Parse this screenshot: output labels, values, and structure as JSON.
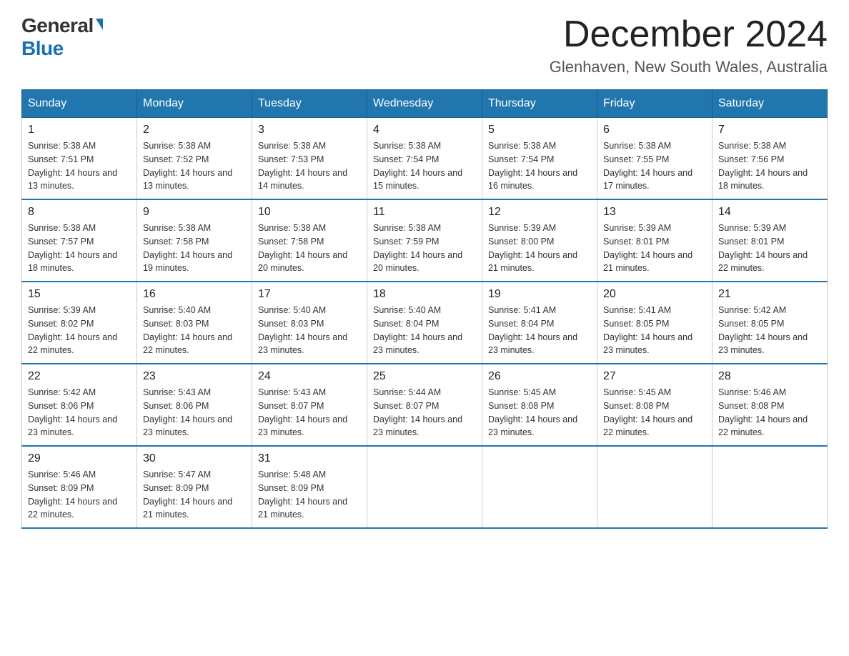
{
  "header": {
    "logo_general": "General",
    "logo_blue": "Blue",
    "month_title": "December 2024",
    "location": "Glenhaven, New South Wales, Australia"
  },
  "days_of_week": [
    "Sunday",
    "Monday",
    "Tuesday",
    "Wednesday",
    "Thursday",
    "Friday",
    "Saturday"
  ],
  "weeks": [
    [
      {
        "day": "1",
        "sunrise": "5:38 AM",
        "sunset": "7:51 PM",
        "daylight": "14 hours and 13 minutes."
      },
      {
        "day": "2",
        "sunrise": "5:38 AM",
        "sunset": "7:52 PM",
        "daylight": "14 hours and 13 minutes."
      },
      {
        "day": "3",
        "sunrise": "5:38 AM",
        "sunset": "7:53 PM",
        "daylight": "14 hours and 14 minutes."
      },
      {
        "day": "4",
        "sunrise": "5:38 AM",
        "sunset": "7:54 PM",
        "daylight": "14 hours and 15 minutes."
      },
      {
        "day": "5",
        "sunrise": "5:38 AM",
        "sunset": "7:54 PM",
        "daylight": "14 hours and 16 minutes."
      },
      {
        "day": "6",
        "sunrise": "5:38 AM",
        "sunset": "7:55 PM",
        "daylight": "14 hours and 17 minutes."
      },
      {
        "day": "7",
        "sunrise": "5:38 AM",
        "sunset": "7:56 PM",
        "daylight": "14 hours and 18 minutes."
      }
    ],
    [
      {
        "day": "8",
        "sunrise": "5:38 AM",
        "sunset": "7:57 PM",
        "daylight": "14 hours and 18 minutes."
      },
      {
        "day": "9",
        "sunrise": "5:38 AM",
        "sunset": "7:58 PM",
        "daylight": "14 hours and 19 minutes."
      },
      {
        "day": "10",
        "sunrise": "5:38 AM",
        "sunset": "7:58 PM",
        "daylight": "14 hours and 20 minutes."
      },
      {
        "day": "11",
        "sunrise": "5:38 AM",
        "sunset": "7:59 PM",
        "daylight": "14 hours and 20 minutes."
      },
      {
        "day": "12",
        "sunrise": "5:39 AM",
        "sunset": "8:00 PM",
        "daylight": "14 hours and 21 minutes."
      },
      {
        "day": "13",
        "sunrise": "5:39 AM",
        "sunset": "8:01 PM",
        "daylight": "14 hours and 21 minutes."
      },
      {
        "day": "14",
        "sunrise": "5:39 AM",
        "sunset": "8:01 PM",
        "daylight": "14 hours and 22 minutes."
      }
    ],
    [
      {
        "day": "15",
        "sunrise": "5:39 AM",
        "sunset": "8:02 PM",
        "daylight": "14 hours and 22 minutes."
      },
      {
        "day": "16",
        "sunrise": "5:40 AM",
        "sunset": "8:03 PM",
        "daylight": "14 hours and 22 minutes."
      },
      {
        "day": "17",
        "sunrise": "5:40 AM",
        "sunset": "8:03 PM",
        "daylight": "14 hours and 23 minutes."
      },
      {
        "day": "18",
        "sunrise": "5:40 AM",
        "sunset": "8:04 PM",
        "daylight": "14 hours and 23 minutes."
      },
      {
        "day": "19",
        "sunrise": "5:41 AM",
        "sunset": "8:04 PM",
        "daylight": "14 hours and 23 minutes."
      },
      {
        "day": "20",
        "sunrise": "5:41 AM",
        "sunset": "8:05 PM",
        "daylight": "14 hours and 23 minutes."
      },
      {
        "day": "21",
        "sunrise": "5:42 AM",
        "sunset": "8:05 PM",
        "daylight": "14 hours and 23 minutes."
      }
    ],
    [
      {
        "day": "22",
        "sunrise": "5:42 AM",
        "sunset": "8:06 PM",
        "daylight": "14 hours and 23 minutes."
      },
      {
        "day": "23",
        "sunrise": "5:43 AM",
        "sunset": "8:06 PM",
        "daylight": "14 hours and 23 minutes."
      },
      {
        "day": "24",
        "sunrise": "5:43 AM",
        "sunset": "8:07 PM",
        "daylight": "14 hours and 23 minutes."
      },
      {
        "day": "25",
        "sunrise": "5:44 AM",
        "sunset": "8:07 PM",
        "daylight": "14 hours and 23 minutes."
      },
      {
        "day": "26",
        "sunrise": "5:45 AM",
        "sunset": "8:08 PM",
        "daylight": "14 hours and 23 minutes."
      },
      {
        "day": "27",
        "sunrise": "5:45 AM",
        "sunset": "8:08 PM",
        "daylight": "14 hours and 22 minutes."
      },
      {
        "day": "28",
        "sunrise": "5:46 AM",
        "sunset": "8:08 PM",
        "daylight": "14 hours and 22 minutes."
      }
    ],
    [
      {
        "day": "29",
        "sunrise": "5:46 AM",
        "sunset": "8:09 PM",
        "daylight": "14 hours and 22 minutes."
      },
      {
        "day": "30",
        "sunrise": "5:47 AM",
        "sunset": "8:09 PM",
        "daylight": "14 hours and 21 minutes."
      },
      {
        "day": "31",
        "sunrise": "5:48 AM",
        "sunset": "8:09 PM",
        "daylight": "14 hours and 21 minutes."
      },
      null,
      null,
      null,
      null
    ]
  ],
  "labels": {
    "sunrise": "Sunrise:",
    "sunset": "Sunset:",
    "daylight": "Daylight:"
  }
}
